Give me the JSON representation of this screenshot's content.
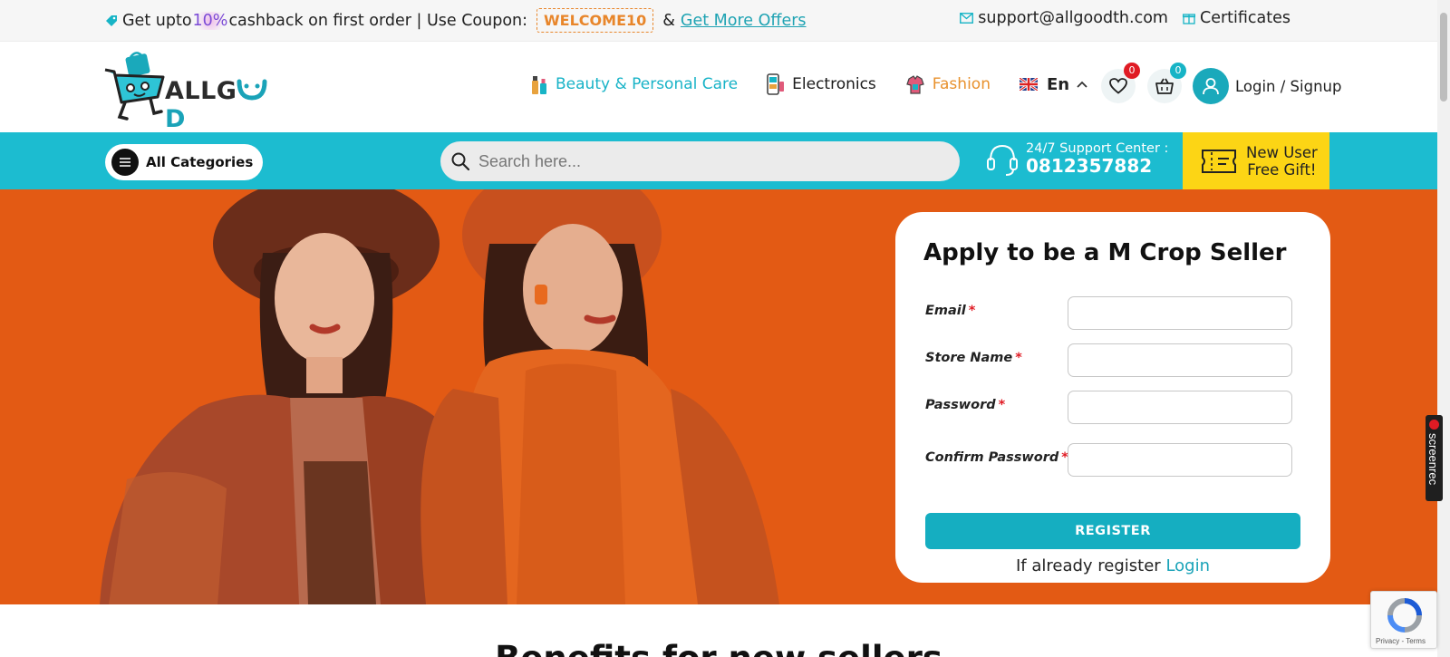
{
  "topbar": {
    "promo_prefix": "Get upto ",
    "promo_percent": "10%",
    "promo_mid": " cashback on first order | Use Coupon:",
    "coupon_code": "WELCOME10",
    "amp": "&",
    "offers_link": "Get More Offers",
    "support_email": "support@allgoodth.com",
    "certificates": "Certificates"
  },
  "header": {
    "logo_text_a": "ALLG",
    "logo_text_d": "D",
    "nav": [
      {
        "label": "Beauty & Personal Care",
        "color": "#18b3c7"
      },
      {
        "label": "Electronics",
        "color": "#1a1a1a"
      },
      {
        "label": "Fashion",
        "color": "#e8912d"
      }
    ],
    "language": "En",
    "wishlist_count": "0",
    "cart_count": "0",
    "login_label": "Login / Signup"
  },
  "searchbar": {
    "all_categories": "All Categories",
    "search_placeholder": "Search here...",
    "support_title": "24/7 Support Center :",
    "support_phone": "0812357882",
    "gift_line1": "New User",
    "gift_line2": "Free Gift!"
  },
  "form": {
    "title": "Apply to be a M Crop Seller",
    "fields": [
      {
        "label": "Email",
        "required_mark": "*"
      },
      {
        "label": "Store Name",
        "required_mark": "*"
      },
      {
        "label": "Password",
        "required_mark": "*"
      },
      {
        "label": "Confirm Password",
        "required_mark": "*"
      }
    ],
    "register_button": "REGISTER",
    "already_text": "If already register ",
    "login_link": "Login"
  },
  "section": {
    "benefits_title": "Benefits for new sellers"
  },
  "overlays": {
    "screenrec_label": "screenrec",
    "recaptcha_terms": "Privacy - Terms"
  },
  "colors": {
    "accent": "#1cbcd0",
    "hero_bg": "#e35a14",
    "gift_bg": "#fcd515",
    "coupon": "#e8862b"
  }
}
